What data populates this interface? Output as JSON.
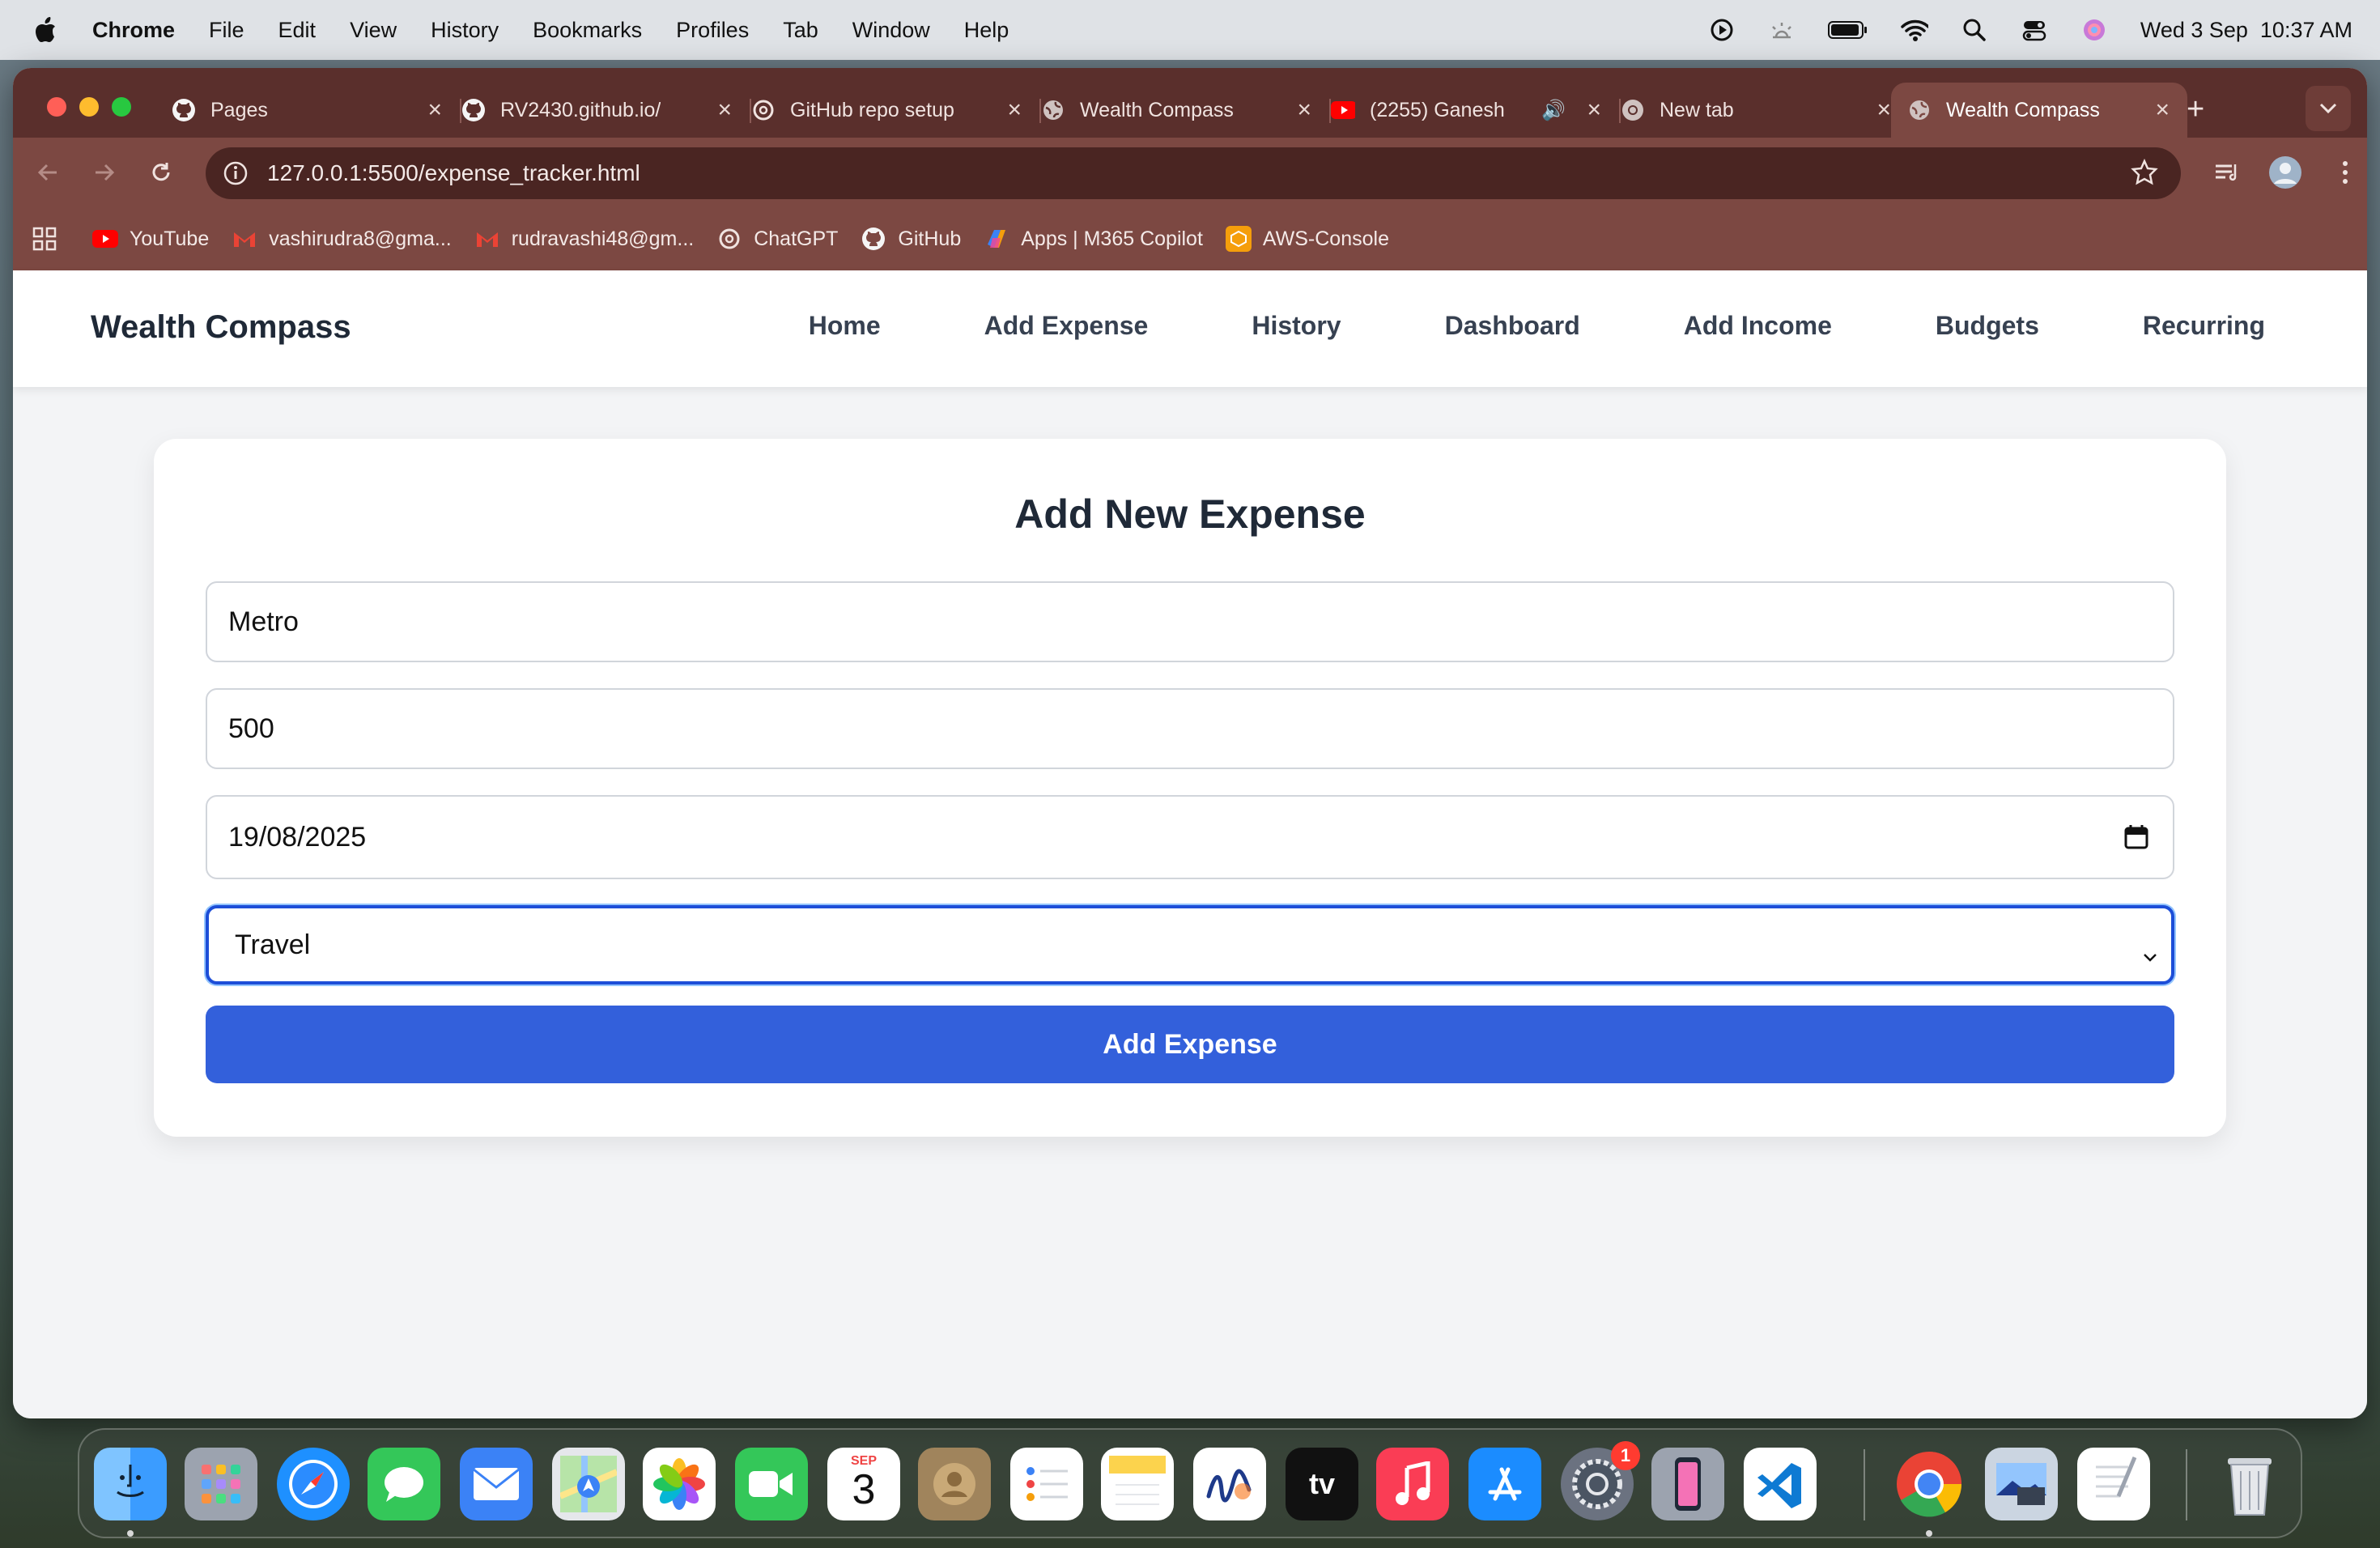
{
  "menubar": {
    "app": "Chrome",
    "menus": [
      "File",
      "Edit",
      "View",
      "History",
      "Bookmarks",
      "Profiles",
      "Tab",
      "Window",
      "Help"
    ],
    "datetime": "Wed 3 Sep  10:37 AM"
  },
  "tabs": [
    {
      "label": "Pages",
      "icon": "github-icon"
    },
    {
      "label": "RV2430.github.io/",
      "icon": "github-icon"
    },
    {
      "label": "GitHub repo setup",
      "icon": "chatgpt-icon"
    },
    {
      "label": "Wealth Compass",
      "icon": "globe-icon"
    },
    {
      "label": "(2255) Ganesh",
      "icon": "youtube-icon"
    },
    {
      "label": "New tab",
      "icon": "chrome-icon"
    },
    {
      "label": "Wealth Compass",
      "icon": "globe-icon",
      "active": true
    }
  ],
  "omnibox": {
    "url": "127.0.0.1:5500/expense_tracker.html"
  },
  "bookmarks": [
    {
      "label": "YouTube",
      "icon": "youtube-icon"
    },
    {
      "label": "vashirudra8@gma...",
      "icon": "gmail-icon"
    },
    {
      "label": "rudravashi48@gm...",
      "icon": "gmail-icon"
    },
    {
      "label": "ChatGPT",
      "icon": "chatgpt-icon"
    },
    {
      "label": "GitHub",
      "icon": "github-icon"
    },
    {
      "label": "Apps | M365 Copilot",
      "icon": "copilot-icon"
    },
    {
      "label": "AWS-Console",
      "icon": "aws-icon"
    }
  ],
  "site": {
    "brand": "Wealth Compass",
    "nav": [
      "Home",
      "Add Expense",
      "History",
      "Dashboard",
      "Add Income",
      "Budgets",
      "Recurring"
    ]
  },
  "form": {
    "title": "Add New Expense",
    "description_value": "Metro",
    "amount_value": "500",
    "date_value": "19/08/2025",
    "category_value": "Travel",
    "submit_label": "Add Expense"
  },
  "dock": {
    "calendar_month": "SEP",
    "calendar_day": "3",
    "settings_badge": "1",
    "tv_label": "tv"
  },
  "colors": {
    "accent": "#3360db",
    "tabstrip": "#5a2f2c",
    "toolbar": "#7c4842",
    "focus": "#1d4ed8"
  }
}
